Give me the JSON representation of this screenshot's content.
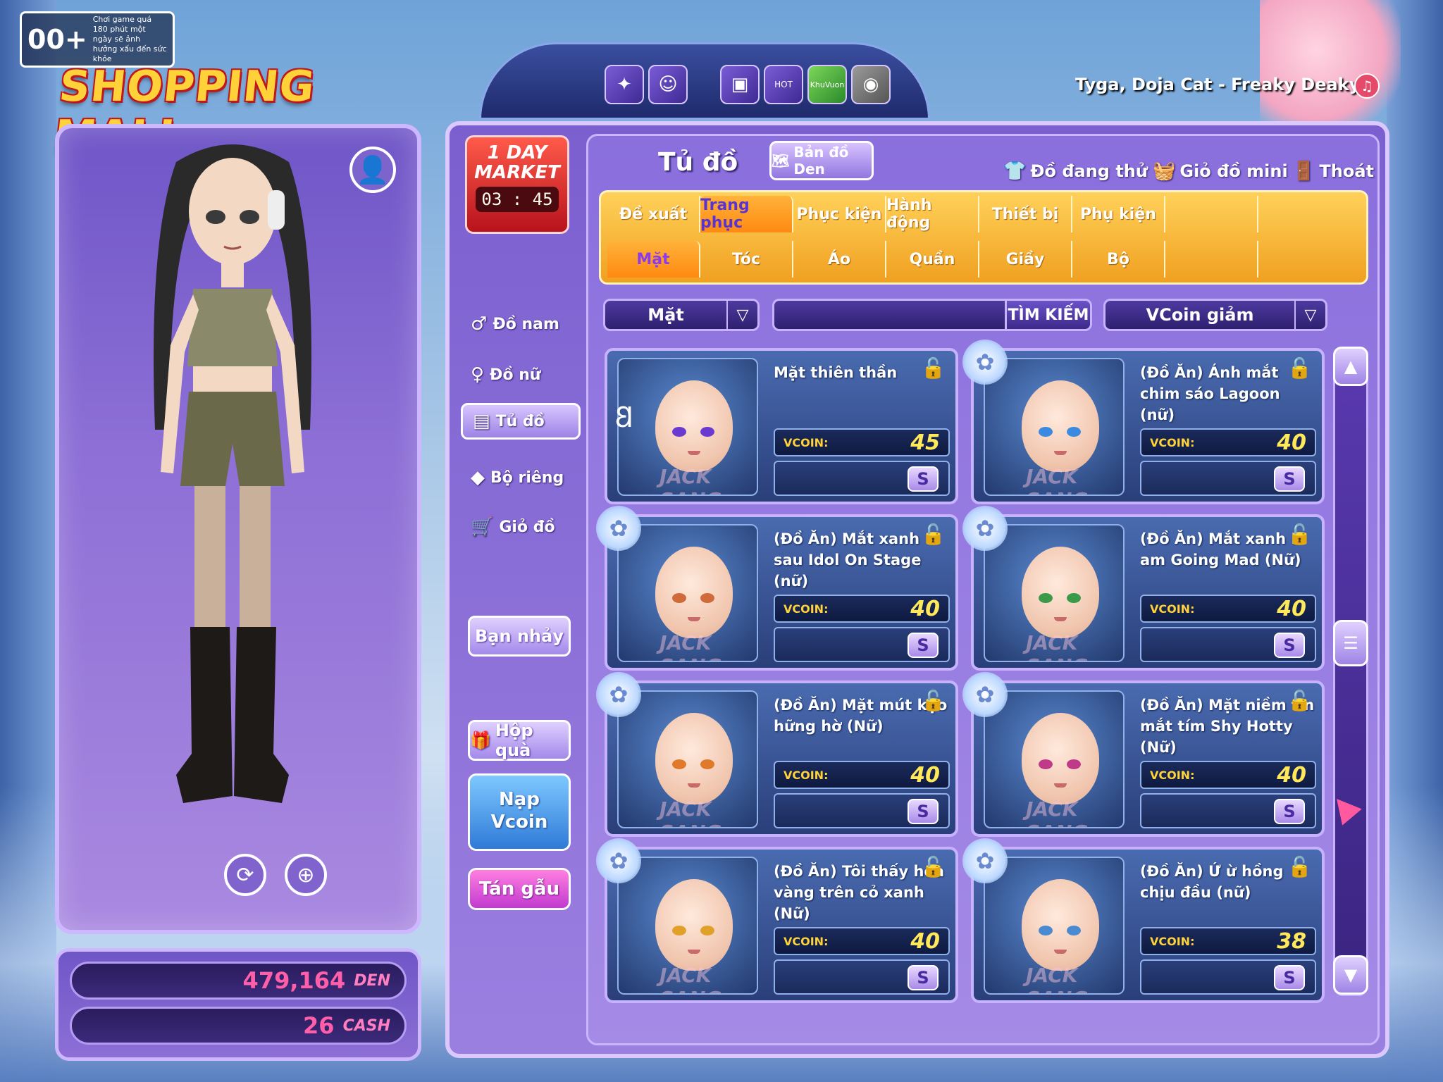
{
  "age_rating": {
    "label": "00+",
    "notice": "Chơi game quá 180 phút một ngày sẽ ảnh hưởng xấu đến sức khỏe"
  },
  "logo": "SHOPPING MALL",
  "top_icons": [
    "butterfly-icon",
    "ghost-icon",
    "tv-icon",
    "hot-box-icon",
    "khu-vuon-icon",
    "stone-icon"
  ],
  "top_icon_labels": {
    "hot": "HOT",
    "garden": "KhuVuon"
  },
  "song": "Tyga, Doja Cat - Freaky Deaky",
  "one_day_market": {
    "title": "1 DAY MARKET",
    "timer": "03 : 45"
  },
  "header": {
    "title": "Tủ đồ",
    "map_button": "Bản đồ Den",
    "trying_on": "Đồ đang thử",
    "mini_cart": "Giỏ đồ mini",
    "exit": "Thoát"
  },
  "tabs": [
    "Đề xuất",
    "Trang phục",
    "Phục kiện",
    "Hành động",
    "Thiết bị",
    "Phụ kiện"
  ],
  "active_tab": "Trang phục",
  "subtabs": [
    "Mặt",
    "Tóc",
    "Áo",
    "Quần",
    "Giầy",
    "Bộ"
  ],
  "active_subtab": "Mặt",
  "sidebar": [
    {
      "label": "Đồ nam",
      "icon": "male-icon"
    },
    {
      "label": "Đồ nữ",
      "icon": "female-icon"
    },
    {
      "label": "Tủ đồ",
      "icon": "wardrobe-icon"
    },
    {
      "label": "Bộ riêng",
      "icon": "set-icon"
    },
    {
      "label": "Giỏ đồ",
      "icon": "cart-icon"
    }
  ],
  "side_buttons": {
    "dance_partner": "Bạn nhảy",
    "gift_box": "Hộp quà",
    "topup_line1": "Nạp",
    "topup_line2": "Vcoin",
    "chat": "Tán gẫu"
  },
  "filter": {
    "category": "Mặt",
    "search_placeholder": "",
    "search_button": "TÌM KIẾM",
    "sort": "VCoin giảm"
  },
  "price_label": "VCOIN:",
  "buy_label": "S",
  "watermark": "JACK SANG",
  "items": [
    {
      "name": "Mặt thiên thần",
      "price": "45",
      "eye_color": "#6a3ad0",
      "has_ribbon": false
    },
    {
      "name": "(Đồ Ăn) Ánh mắt chim sáo Lagoon (nữ)",
      "price": "40",
      "eye_color": "#3a8ae0",
      "has_ribbon": true
    },
    {
      "name": "(Đồ Ăn) Mắt xanh sau Idol On Stage (nữ)",
      "price": "40",
      "eye_color": "#d06a3a",
      "has_ribbon": true
    },
    {
      "name": "(Đồ Ăn) Mắt xanh I am Going Mad (Nữ)",
      "price": "40",
      "eye_color": "#3a9a4a",
      "has_ribbon": true
    },
    {
      "name": "(Đồ Ăn) Mặt mút kẹo hững hờ (Nữ)",
      "price": "40",
      "eye_color": "#e07a2a",
      "has_ribbon": true
    },
    {
      "name": "(Đồ Ăn) Mặt niềm tin mắt tím Shy Hotty (Nữ)",
      "price": "40",
      "eye_color": "#c03a8a",
      "has_ribbon": true
    },
    {
      "name": "(Đồ Ăn) Tôi thấy hoa vàng trên cỏ xanh (Nữ)",
      "price": "40",
      "eye_color": "#e0a02a",
      "has_ribbon": true
    },
    {
      "name": "(Đồ Ăn) Ứ ừ hồng chịu đầu (nữ)",
      "price": "38",
      "eye_color": "#4a8ad0",
      "has_ribbon": true
    }
  ],
  "currency": {
    "den_value": "479,164",
    "den_label": "DEN",
    "cash_value": "26",
    "cash_label": "CASH"
  }
}
